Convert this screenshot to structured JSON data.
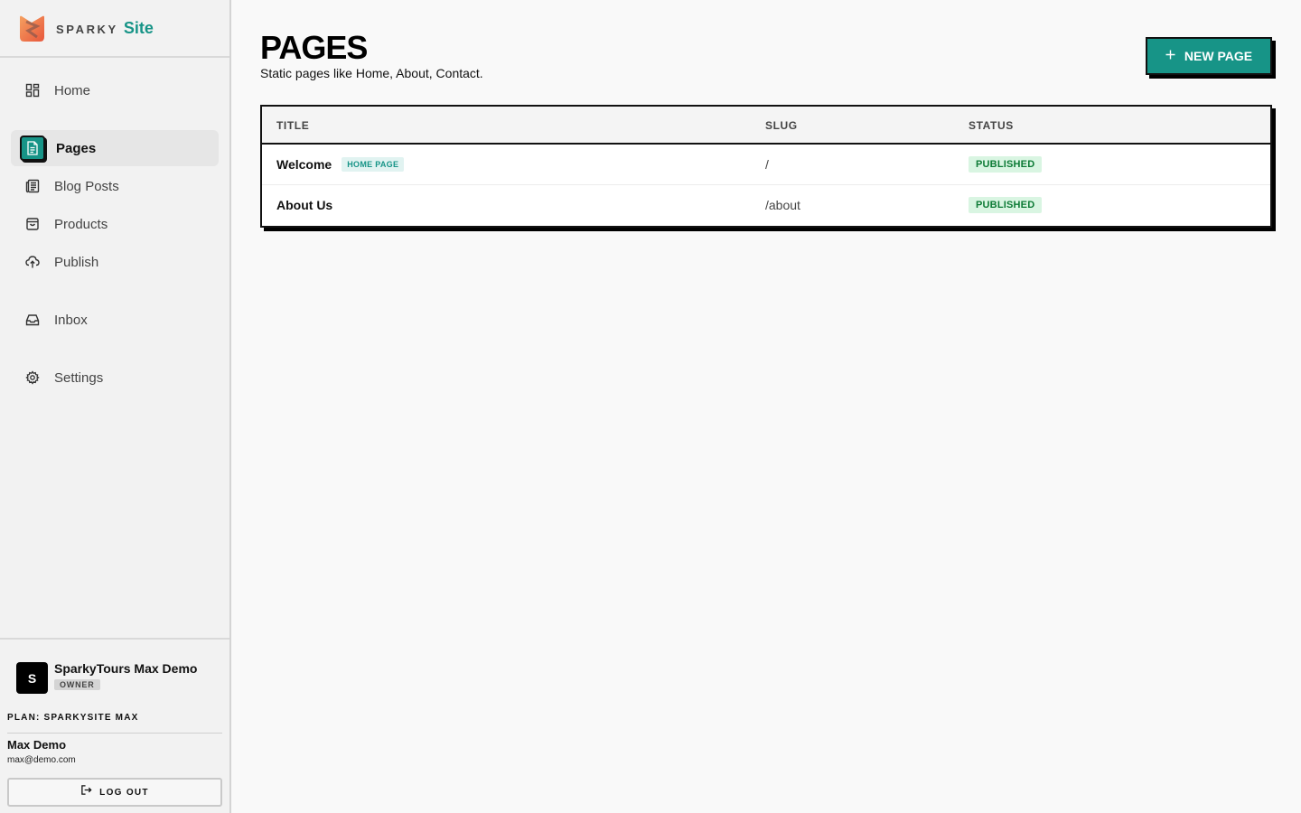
{
  "brand": {
    "name_prefix": "SPARKY",
    "name_suffix": "Site",
    "accent_color": "#179487"
  },
  "sidebar": {
    "items": [
      {
        "label": "Home",
        "icon": "dashboard-icon",
        "active": false
      },
      {
        "label": "Pages",
        "icon": "document-icon",
        "active": true
      },
      {
        "label": "Blog Posts",
        "icon": "newspaper-icon",
        "active": false
      },
      {
        "label": "Products",
        "icon": "shopping-bag-icon",
        "active": false
      },
      {
        "label": "Publish",
        "icon": "cloud-upload-icon",
        "active": false
      },
      {
        "label": "Inbox",
        "icon": "inbox-icon",
        "active": false
      },
      {
        "label": "Settings",
        "icon": "gear-icon",
        "active": false
      }
    ]
  },
  "account": {
    "org_initial": "S",
    "org_name": "SparkyTours Max Demo",
    "role": "OWNER",
    "plan": "PLAN: SPARKYSITE MAX",
    "user_name": "Max Demo",
    "user_email": "max@demo.com",
    "logout_label": "LOG OUT"
  },
  "main": {
    "title": "PAGES",
    "subtitle": "Static pages like Home, About, Contact.",
    "new_button_label": "NEW PAGE",
    "table": {
      "columns": [
        "TITLE",
        "SLUG",
        "STATUS"
      ],
      "rows": [
        {
          "title": "Welcome",
          "badge": "HOME PAGE",
          "slug": "/",
          "status": "PUBLISHED"
        },
        {
          "title": "About Us",
          "badge": "",
          "slug": "/about",
          "status": "PUBLISHED"
        }
      ]
    }
  }
}
